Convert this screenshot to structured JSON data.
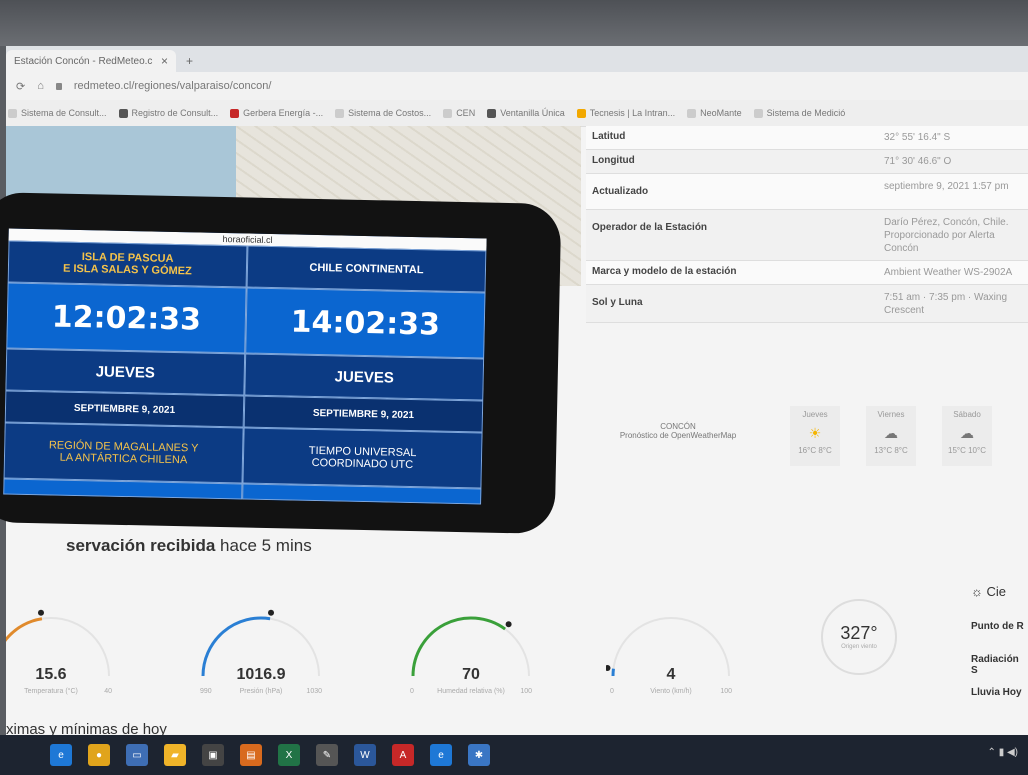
{
  "browser": {
    "tab_title": "Estación Concón - RedMeteo.cl",
    "tab_close": "×",
    "new_tab": "+",
    "url": "redmeteo.cl/regiones/valparaiso/concon/",
    "bookmarks": [
      {
        "label": "Sistema de Consult...",
        "color": "#cccccc"
      },
      {
        "label": "Registro de Consult...",
        "color": "#555555"
      },
      {
        "label": "Gerbera Energía -...",
        "color": "#c62828"
      },
      {
        "label": "Sistema de Costos...",
        "color": "#cccccc"
      },
      {
        "label": "CEN",
        "color": "#cccccc"
      },
      {
        "label": "Ventanilla Única",
        "color": "#555555"
      },
      {
        "label": "Tecnesis | La Intran...",
        "color": "#f2a800"
      },
      {
        "label": "NeoMante",
        "color": "#cccccc"
      },
      {
        "label": "Sistema de Medició",
        "color": "#cccccc"
      }
    ]
  },
  "station_info": [
    {
      "key": "Latitud",
      "value": "32° 55' 16.4\" S"
    },
    {
      "key": "Longitud",
      "value": "71° 30' 46.6\" O"
    },
    {
      "key": "Actualizado",
      "value": "septiembre 9, 2021 1:57 pm"
    },
    {
      "key": "Operador de la Estación",
      "value": "Darío Pérez, Concón, Chile. Proporcionado por Alerta Concón"
    },
    {
      "key": "Marca y modelo de la estación",
      "value": "Ambient Weather WS-2902A"
    },
    {
      "key": "Sol y Luna",
      "value": "7:51 am · 7:35 pm · Waxing Crescent"
    }
  ],
  "forecast": {
    "location": "CONCÓN",
    "source": "Pronóstico de OpenWeatherMap",
    "days": [
      {
        "day": "Jueves",
        "symbol": "☀",
        "temps": "16°C  8°C"
      },
      {
        "day": "Viernes",
        "symbol": "☁",
        "temps": "13°C  8°C"
      },
      {
        "day": "Sábado",
        "symbol": "☁",
        "temps": "15°C  10°C"
      }
    ]
  },
  "observation": {
    "prefix": "servación recibida",
    "suffix": "hace 5 mins"
  },
  "gauges": [
    {
      "value": "15.6",
      "label": "Temperatura (°C)",
      "min": "",
      "max": "40",
      "fraction": 0.45,
      "color": "#e08a2c"
    },
    {
      "value": "1016.9",
      "label": "Presión (hPa)",
      "min": "990",
      "max": "1030",
      "fraction": 0.55,
      "color": "#2a7fd4"
    },
    {
      "value": "70",
      "label": "Humedad relativa (%)",
      "min": "0",
      "max": "100",
      "fraction": 0.7,
      "color": "#3aa03a"
    },
    {
      "value": "4",
      "label": "Viento (km/h)",
      "min": "0",
      "max": "100",
      "fraction": 0.04,
      "color": "#2a7fd4"
    }
  ],
  "wind_direction": {
    "value": "327°",
    "label": "Origen viento"
  },
  "side_labels": [
    "Cie",
    "Punto de R",
    "Radiación S",
    "Lluvia Hoy"
  ],
  "minmax_heading": "ximas y mínimas de hoy",
  "phone": {
    "source": "horaoficial.cl",
    "cells": {
      "left_head": "ISLA DE PASCUA\nE ISLA SALAS Y GÓMEZ",
      "right_head": "CHILE CONTINENTAL",
      "left_time": "12:02:33",
      "right_time": "14:02:33",
      "left_day": "JUEVES",
      "right_day": "JUEVES",
      "left_date": "SEPTIEMBRE 9, 2021",
      "right_date": "SEPTIEMBRE 9, 2021",
      "left_region": "REGIÓN DE MAGALLANES Y\nLA ANTÁRTICA CHILENA",
      "right_region": "TIEMPO UNIVERSAL\nCOORDINADO UTC"
    }
  }
}
